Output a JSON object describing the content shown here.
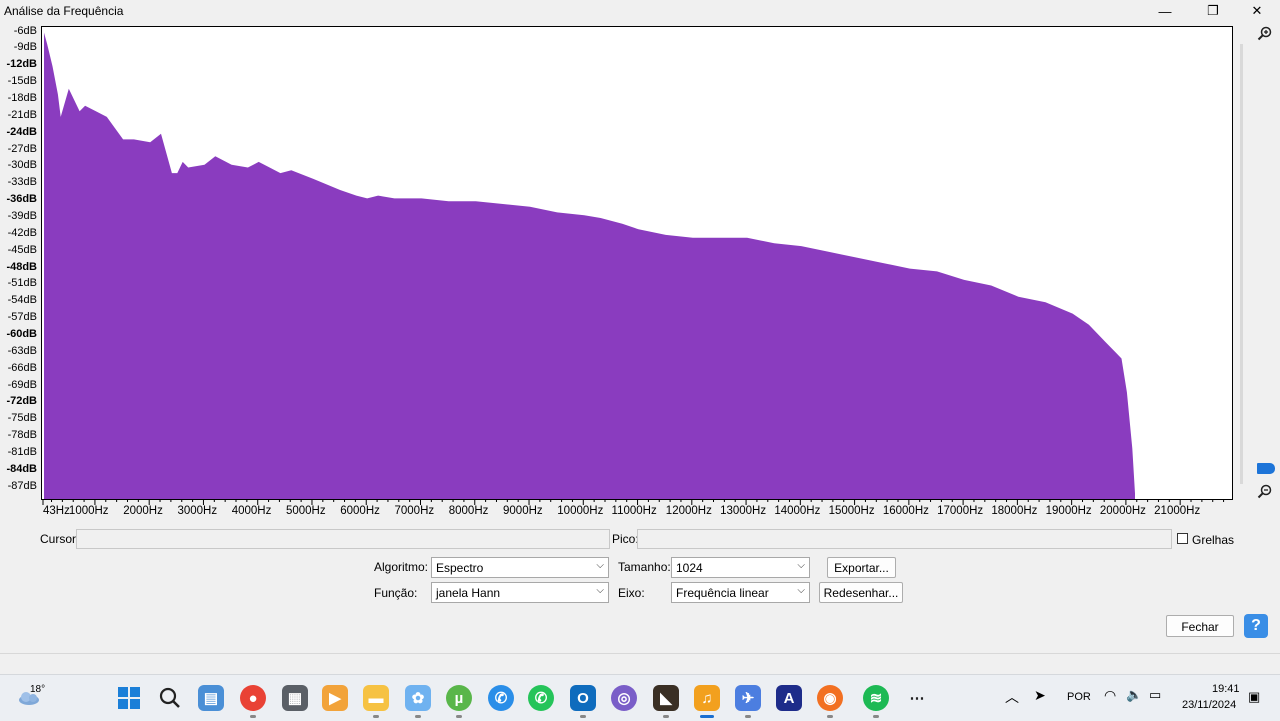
{
  "window": {
    "title": "Análise da Frequência",
    "minimize_glyph": "—",
    "restore_glyph": "❐",
    "close_glyph": "✕"
  },
  "plot": {
    "y_ticks": [
      {
        "label": "-6dB",
        "bold": false
      },
      {
        "label": "-9dB",
        "bold": false
      },
      {
        "label": "-12dB",
        "bold": true
      },
      {
        "label": "-15dB",
        "bold": false
      },
      {
        "label": "-18dB",
        "bold": false
      },
      {
        "label": "-21dB",
        "bold": false
      },
      {
        "label": "-24dB",
        "bold": true
      },
      {
        "label": "-27dB",
        "bold": false
      },
      {
        "label": "-30dB",
        "bold": false
      },
      {
        "label": "-33dB",
        "bold": false
      },
      {
        "label": "-36dB",
        "bold": true
      },
      {
        "label": "-39dB",
        "bold": false
      },
      {
        "label": "-42dB",
        "bold": false
      },
      {
        "label": "-45dB",
        "bold": false
      },
      {
        "label": "-48dB",
        "bold": true
      },
      {
        "label": "-51dB",
        "bold": false
      },
      {
        "label": "-54dB",
        "bold": false
      },
      {
        "label": "-57dB",
        "bold": false
      },
      {
        "label": "-60dB",
        "bold": true
      },
      {
        "label": "-63dB",
        "bold": false
      },
      {
        "label": "-66dB",
        "bold": false
      },
      {
        "label": "-69dB",
        "bold": false
      },
      {
        "label": "-72dB",
        "bold": true
      },
      {
        "label": "-75dB",
        "bold": false
      },
      {
        "label": "-78dB",
        "bold": false
      },
      {
        "label": "-81dB",
        "bold": false
      },
      {
        "label": "-84dB",
        "bold": true
      },
      {
        "label": "-87dB",
        "bold": false
      }
    ],
    "x_ticks": [
      "43Hz",
      "1000Hz",
      "2000Hz",
      "3000Hz",
      "4000Hz",
      "5000Hz",
      "6000Hz",
      "7000Hz",
      "8000Hz",
      "9000Hz",
      "10000Hz",
      "11000Hz",
      "12000Hz",
      "13000Hz",
      "14000Hz",
      "15000Hz",
      "16000Hz",
      "17000Hz",
      "18000Hz",
      "19000Hz",
      "20000Hz",
      "21000Hz"
    ],
    "fill_color": "#8a3cbf",
    "zoom_in_icon": "zoom-in",
    "zoom_out_icon": "zoom-out"
  },
  "chart_data": {
    "type": "area",
    "xlabel": "",
    "ylabel": "",
    "xlim": [
      43,
      21900
    ],
    "ylim": [
      -89,
      -5
    ],
    "grid": false,
    "x": [
      43,
      100,
      200,
      300,
      350,
      500,
      700,
      800,
      1000,
      1200,
      1500,
      1700,
      2000,
      2200,
      2400,
      2500,
      2600,
      2700,
      3000,
      3200,
      3500,
      3800,
      4000,
      4200,
      4400,
      4600,
      5000,
      5500,
      5800,
      6000,
      6200,
      6500,
      7000,
      7500,
      8000,
      8500,
      9000,
      9500,
      10000,
      10300,
      10700,
      11000,
      11500,
      12000,
      12500,
      13000,
      13500,
      14000,
      14500,
      15000,
      15500,
      16000,
      16500,
      17000,
      17500,
      18000,
      18500,
      19000,
      19300,
      19600,
      19800,
      19900,
      20000,
      20100,
      20150
    ],
    "y": [
      -6,
      -8,
      -12,
      -17,
      -21,
      -16,
      -20,
      -19,
      -20,
      -21,
      -25,
      -25,
      -25.5,
      -24,
      -31,
      -31,
      -29,
      -30,
      -29.5,
      -28,
      -29.5,
      -30,
      -29,
      -30,
      -31,
      -30.5,
      -32,
      -34,
      -35,
      -35.5,
      -35,
      -35.5,
      -35.5,
      -36,
      -36,
      -36.5,
      -37,
      -38,
      -38.5,
      -39,
      -40,
      -41,
      -42,
      -42.5,
      -42.5,
      -42.5,
      -43.5,
      -44,
      -45,
      -46,
      -47,
      -48,
      -48.5,
      -50,
      -51,
      -53,
      -54,
      -56,
      -58,
      -61,
      -63,
      -64,
      -70,
      -80,
      -88
    ]
  },
  "bottom": {
    "cursor_label": "Cursor:",
    "cursor_value": "",
    "peak_label": "Pico:",
    "peak_value": "",
    "grid_label": "Grelhas",
    "algorithm_label": "Algoritmo:",
    "algorithm_value": "Espectro",
    "size_label": "Tamanho:",
    "size_value": "1024",
    "export_button": "Exportar...",
    "function_label": "Função:",
    "function_value": "janela Hann",
    "axis_label": "Eixo:",
    "axis_value": "Frequência linear",
    "redraw_button": "Redesenhar...",
    "close_button": "Fechar",
    "help_glyph": "?"
  },
  "taskbar": {
    "weather_temp": "18°",
    "apps": [
      "windows-start",
      "search",
      "widgets",
      "chrome",
      "calculator",
      "video",
      "files",
      "photos",
      "utorrent",
      "messaging",
      "whatsapp",
      "outlook",
      "podcast",
      "media-player",
      "audacity",
      "plane",
      "arc",
      "firefox",
      "spotify",
      "more"
    ],
    "tray": {
      "language": "POR",
      "time": "19:41",
      "date": "23/11/2024",
      "chevron_glyph": "︿"
    }
  }
}
